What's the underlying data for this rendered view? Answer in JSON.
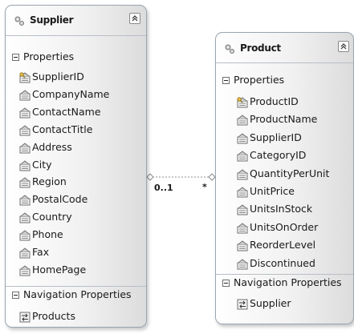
{
  "supplier": {
    "title": "Supplier",
    "properties_label": "Properties",
    "properties": [
      {
        "name": "SupplierID",
        "key": true
      },
      {
        "name": "CompanyName",
        "key": false
      },
      {
        "name": "ContactName",
        "key": false
      },
      {
        "name": "ContactTitle",
        "key": false
      },
      {
        "name": "Address",
        "key": false
      },
      {
        "name": "City",
        "key": false
      },
      {
        "name": "Region",
        "key": false
      },
      {
        "name": "PostalCode",
        "key": false
      },
      {
        "name": "Country",
        "key": false
      },
      {
        "name": "Phone",
        "key": false
      },
      {
        "name": "Fax",
        "key": false
      },
      {
        "name": "HomePage",
        "key": false
      }
    ],
    "navigation_label": "Navigation Properties",
    "navigation": [
      {
        "name": "Products"
      }
    ]
  },
  "product": {
    "title": "Product",
    "properties_label": "Properties",
    "properties": [
      {
        "name": "ProductID",
        "key": true
      },
      {
        "name": "ProductName",
        "key": false
      },
      {
        "name": "SupplierID",
        "key": false
      },
      {
        "name": "CategoryID",
        "key": false
      },
      {
        "name": "QuantityPerUnit",
        "key": false
      },
      {
        "name": "UnitPrice",
        "key": false
      },
      {
        "name": "UnitsInStock",
        "key": false
      },
      {
        "name": "UnitsOnOrder",
        "key": false
      },
      {
        "name": "ReorderLevel",
        "key": false
      },
      {
        "name": "Discontinued",
        "key": false
      }
    ],
    "navigation_label": "Navigation Properties",
    "navigation": [
      {
        "name": "Supplier"
      }
    ]
  },
  "association": {
    "from_multiplicity": "0..1",
    "to_multiplicity": "*"
  },
  "colors": {
    "border": "#9aa4b0",
    "connector": "#8c8c8c"
  }
}
